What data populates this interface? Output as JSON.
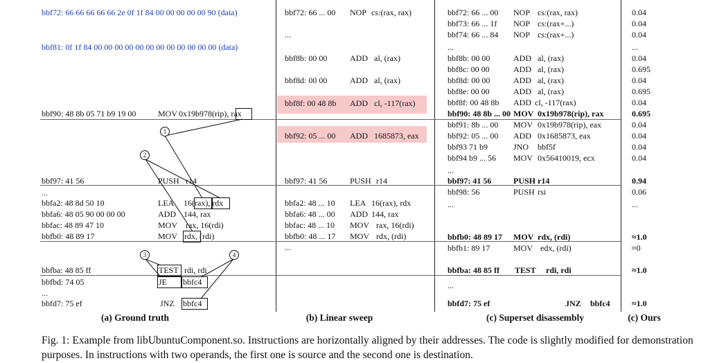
{
  "figure": {
    "caption": "Fig. 1: Example from libUbuntuComponent.so. Instructions are horizontally aligned by their addresses. The code is slightly modified for demonstration purposes. In instructions with two operands, the first one is source and the second one is destination.",
    "columns": [
      {
        "label": "(a) Ground truth"
      },
      {
        "label": "(b) Linear sweep"
      },
      {
        "label": "(c) Superset disassembly"
      },
      {
        "label": "(c) Ours"
      }
    ],
    "ground_truth": {
      "data1": "bbf72:  66 66 66 66 66 2e 0f 1f 84 00 00 00 00 00 90  (data)",
      "data2": "bbf81:  0f 1f 84 00 00 00 00 00 00 00 00 00 00 00 00  (data)",
      "rows": [
        {
          "addr": "bbf90:  48 8b  05 71 b9 19 00",
          "mn": "MOV",
          "ops": "0x19b978(rip), rax"
        },
        {
          "addr": "bbf97:  41 56",
          "mn": "PUSH",
          "ops": "r14"
        },
        {
          "addr": "...",
          "mn": "",
          "ops": ""
        },
        {
          "addr": "bbfa2:  48 8d 50 10",
          "mn": "LEA",
          "ops": "16(rax), rdx"
        },
        {
          "addr": "bbfa6:  48 05 90 00 00 00",
          "mn": "ADD",
          "ops": "144, rax"
        },
        {
          "addr": "bbfac:  48 89 47 10",
          "mn": "MOV",
          "ops": "rax, 16(rdi)"
        },
        {
          "addr": "bbfb0:  48 89 17",
          "mn": "MOV",
          "ops": "rdx, (rdi)"
        },
        {
          "addr": "bbfba:  48 85 ff",
          "mn": "TEST",
          "ops": "rdi, rdi"
        },
        {
          "addr": "bbfbd:  74 05",
          "mn": "JE",
          "ops": "bbfc4"
        },
        {
          "addr": "...",
          "mn": "",
          "ops": ""
        },
        {
          "addr": "bbfd7:  75 ef",
          "mn": "JNZ",
          "ops": "bbfc4"
        }
      ],
      "markers": [
        "1",
        "2",
        "3",
        "4"
      ]
    },
    "linear_sweep": {
      "rows": [
        {
          "addr": "bbf72:  66 ... 00",
          "mn": "NOP",
          "ops": "cs:(rax, rax)"
        },
        {
          "addr": "...",
          "mn": "",
          "ops": ""
        },
        {
          "addr": "bbf8b:  00 00",
          "mn": "ADD",
          "ops": "al, (rax)"
        },
        {
          "addr": "bbf8d:  00 00",
          "mn": "ADD",
          "ops": "al, (rax)"
        },
        {
          "addr": "bbf8f:   00 48 8b",
          "mn": "ADD",
          "ops": "cl, -117(rax)"
        },
        {
          "addr": "bbf92:  05 ... 00",
          "mn": "ADD",
          "ops": "1685873, eax"
        },
        {
          "addr": "bbf97:  41 56",
          "mn": "PUSH",
          "ops": "r14"
        },
        {
          "addr": "bbfa2:  48 ... 10",
          "mn": "LEA",
          "ops": "16(rax), rdx"
        },
        {
          "addr": "bbfa6:  48 ... 00",
          "mn": "ADD",
          "ops": "144, rax"
        },
        {
          "addr": "bbfac:  48 ... 10",
          "mn": "MOV",
          "ops": "rax, 16(rdi)"
        },
        {
          "addr": "bbfb0:  48 ... 17",
          "mn": "MOV",
          "ops": "rdx, (rdi)"
        },
        {
          "addr": "...",
          "mn": "",
          "ops": ""
        }
      ]
    },
    "superset": {
      "rows": [
        {
          "addr": "bbf72:  66 ... 00",
          "mn": "NOP",
          "ops": "cs:(rax, rax)",
          "score": "0.04"
        },
        {
          "addr": "bbf73:  66 ... 1f",
          "mn": "NOP",
          "ops": "cs:(rax+...)",
          "score": "0.04"
        },
        {
          "addr": "bbf74:  66 ... 84",
          "mn": "NOP",
          "ops": "cs:(rax+...)",
          "score": "0.04"
        },
        {
          "addr": "...",
          "mn": "",
          "ops": "",
          "score": "..."
        },
        {
          "addr": "bbf8b:  00 00",
          "mn": "ADD",
          "ops": "al, (rax)",
          "score": "0.04"
        },
        {
          "addr": "bbf8c:  00 00",
          "mn": "ADD",
          "ops": "al, (rax)",
          "score": "0.695"
        },
        {
          "addr": "bbf8d:  00 00",
          "mn": "ADD",
          "ops": "al, (rax)",
          "score": "0.04"
        },
        {
          "addr": "bbf8e:  00 00",
          "mn": "ADD",
          "ops": "al, (rax)",
          "score": "0.695"
        },
        {
          "addr": "bbf8f:   00 48 8b",
          "mn": "ADD",
          "ops": "cl, -117(rax)",
          "score": "0.04"
        },
        {
          "addr": "bbf90:  48 8b  ... 00",
          "mn": "MOV",
          "ops": "0x19b978(rip), rax",
          "score": "0.695"
        },
        {
          "addr": "bbf91:  8b ... 00",
          "mn": "MOV",
          "ops": "0x19b978(rip), eax",
          "score": "0.04"
        },
        {
          "addr": "bbf92:  05 ... 00",
          "mn": "ADD",
          "ops": "0x1685873, eax",
          "score": "0.04"
        },
        {
          "addr": "bbf93  71 b9",
          "mn": "JNO",
          "ops": "bbf5f",
          "score": "0.04"
        },
        {
          "addr": "bbf94  b9 ... 56",
          "mn": "MOV",
          "ops": "0x56410019, ecx",
          "score": "0.04"
        },
        {
          "addr": "...",
          "mn": "",
          "ops": "",
          "score": ""
        },
        {
          "addr": "bbf97:  41 56",
          "mn": "PUSH",
          "ops": "r14",
          "score": "0.94"
        },
        {
          "addr": "bbf98:  56",
          "mn": "PUSH",
          "ops": "rsi",
          "score": "0.06"
        },
        {
          "addr": "...",
          "mn": "",
          "ops": "",
          "score": "..."
        },
        {
          "addr": "bbfb0:  48 89 17",
          "mn": "MOV",
          "ops": "rdx, (rdi)",
          "score": "≈1.0"
        },
        {
          "addr": "bbfb1:  89 17",
          "mn": "MOV",
          "ops": "edx, (rdi)",
          "score": "≈0"
        },
        {
          "addr": "bbfba:  48 85 ff",
          "mn": "TEST",
          "ops": "rdi, rdi",
          "score": "≈1.0"
        },
        {
          "addr": "...",
          "mn": "",
          "ops": "",
          "score": ""
        },
        {
          "addr": "bbfd7:  75 ef",
          "mn": "JNZ",
          "ops": "bbfc4",
          "score": "≈1.0"
        }
      ]
    }
  }
}
